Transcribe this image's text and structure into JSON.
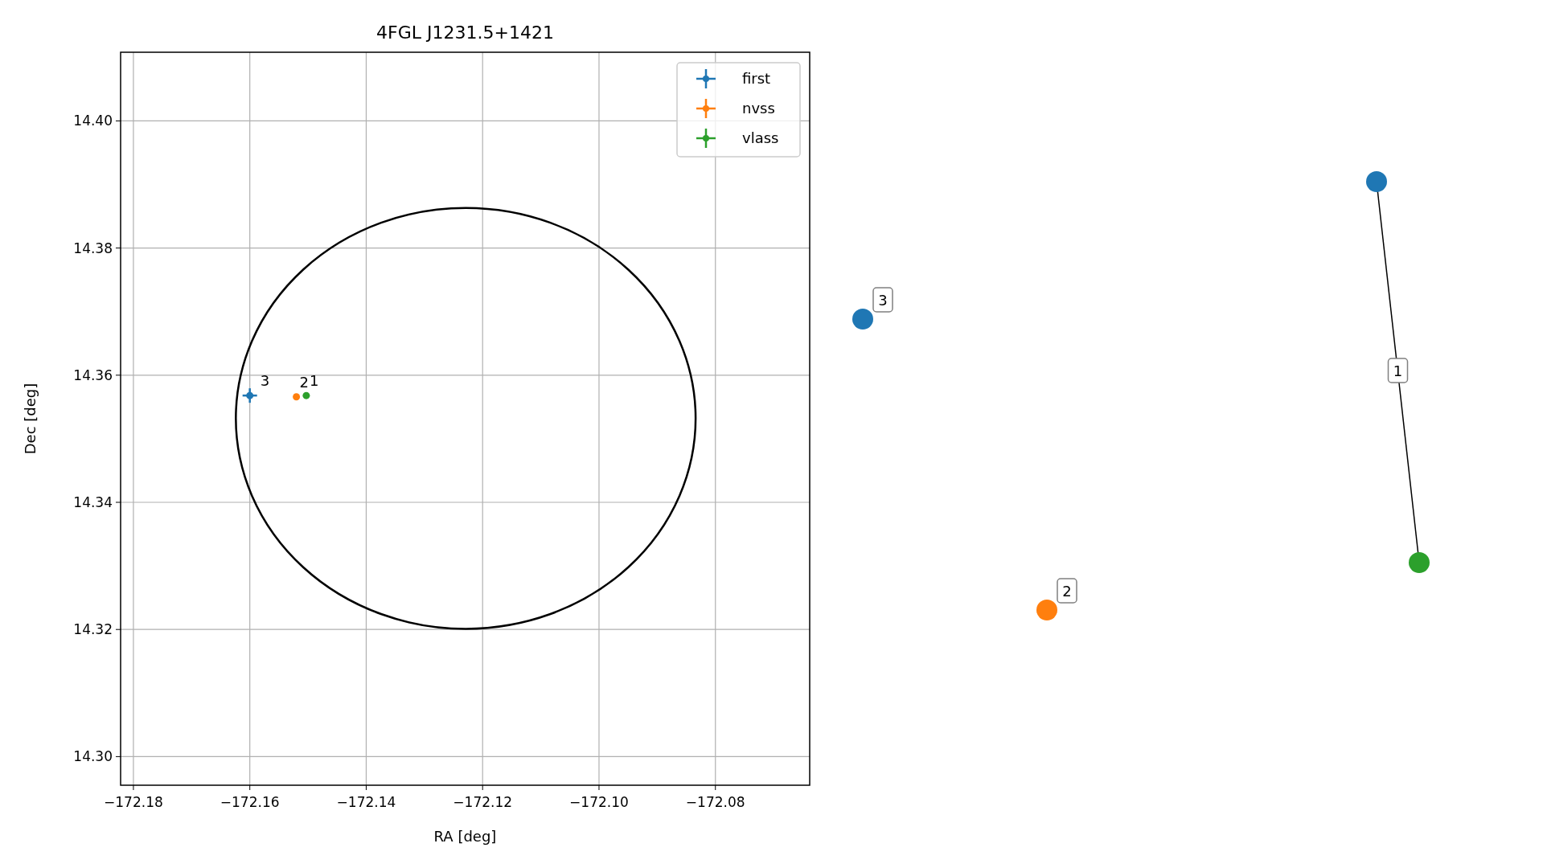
{
  "chart": {
    "chart_data": {
      "type": "scatter",
      "title": "4FGL J1231.5+1421",
      "xlabel": "RA [deg]",
      "ylabel": "Dec [deg]",
      "xlim": [
        -172.1822,
        -172.0638
      ],
      "ylim": [
        14.2955,
        14.4108
      ],
      "xticks": [
        {
          "value": -172.18,
          "label": "−172.18"
        },
        {
          "value": -172.16,
          "label": "−172.16"
        },
        {
          "value": -172.14,
          "label": "−172.14"
        },
        {
          "value": -172.12,
          "label": "−172.12"
        },
        {
          "value": -172.1,
          "label": "−172.10"
        },
        {
          "value": -172.08,
          "label": "−172.08"
        }
      ],
      "yticks": [
        {
          "value": 14.3,
          "label": "14.30"
        },
        {
          "value": 14.32,
          "label": "14.32"
        },
        {
          "value": 14.34,
          "label": "14.34"
        },
        {
          "value": 14.36,
          "label": "14.36"
        },
        {
          "value": 14.38,
          "label": "14.38"
        },
        {
          "value": 14.4,
          "label": "14.40"
        }
      ],
      "grid": true,
      "legend": true,
      "series": [
        {
          "name": "first",
          "color": "#1f77b4",
          "x": [
            -172.16
          ],
          "values": [
            14.3568
          ]
        },
        {
          "name": "nvss",
          "color": "#ff7f0e",
          "x": [
            -172.152
          ],
          "values": [
            14.3566
          ]
        },
        {
          "name": "vlass",
          "color": "#2ca02c",
          "x": [
            -172.1503
          ],
          "values": [
            14.3568
          ]
        }
      ],
      "annotations": [
        "3",
        "2",
        "1"
      ]
    }
  },
  "graph": {
    "nodes": [
      {
        "color": "#1f77b4"
      },
      {
        "color": "#1f77b4",
        "label": "3"
      },
      {
        "color": "#ff7f0e",
        "label": "2"
      },
      {
        "color": "#2ca02c"
      }
    ],
    "edges": [
      {
        "label": "1"
      }
    ]
  }
}
